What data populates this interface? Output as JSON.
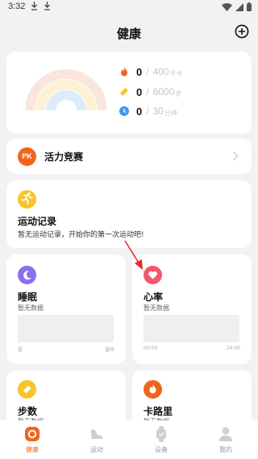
{
  "status_bar": {
    "time": "3:32"
  },
  "header": {
    "title": "健康"
  },
  "summary": {
    "metrics": [
      {
        "icon": "flame-icon",
        "value": "0",
        "goal": "400",
        "unit": "千卡",
        "color": "#f2641e"
      },
      {
        "icon": "footprint-icon",
        "value": "0",
        "goal": "6000",
        "unit": "步",
        "color": "#f7c52b"
      },
      {
        "icon": "clock-icon",
        "value": "0",
        "goal": "30",
        "unit": "分钟",
        "color": "#3d9cf0"
      }
    ]
  },
  "pk": {
    "badge": "PK",
    "label": "活力竞赛"
  },
  "sport": {
    "title": "运动记录",
    "subtitle": "暂无运动记录，开始你的第一次运动吧!"
  },
  "sleep": {
    "title": "睡眠",
    "subtitle": "暂无数据",
    "axis_start": "昼",
    "axis_end": "昼时"
  },
  "heart": {
    "title": "心率",
    "subtitle": "暂无数据",
    "axis_start": "00:00",
    "axis_end": "24:00"
  },
  "steps": {
    "title": "步数",
    "subtitle": "暂无数据"
  },
  "calories": {
    "title": "卡路里",
    "subtitle": "暂无数据"
  },
  "tabs": [
    {
      "label": "健康",
      "icon": "health-icon",
      "active": true
    },
    {
      "label": "运动",
      "icon": "sport-shoe-icon",
      "active": false
    },
    {
      "label": "设备",
      "icon": "watch-icon",
      "active": false
    },
    {
      "label": "我的",
      "icon": "profile-icon",
      "active": false
    }
  ],
  "colors": {
    "accent": "#f2641e",
    "sleep": "#8a6ff0",
    "heart": "#f05a6a",
    "steps": "#f7c52b",
    "calories": "#f2641e"
  }
}
